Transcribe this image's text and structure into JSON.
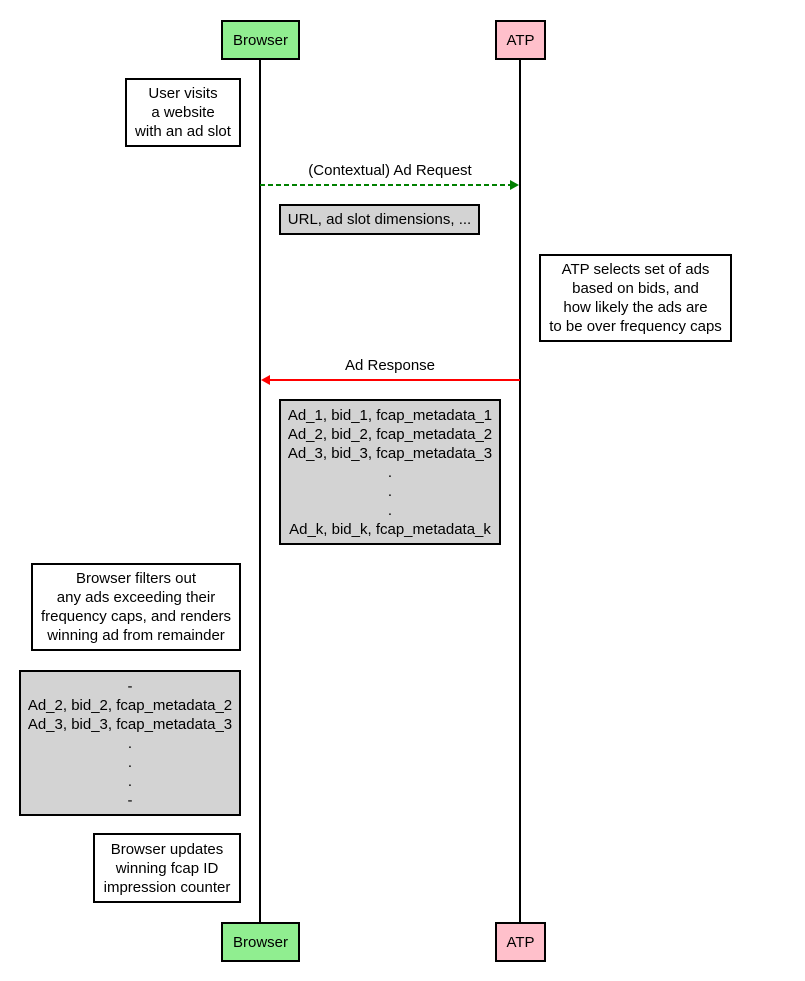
{
  "participants": [
    {
      "name": "Browser",
      "color": "#90ee90"
    },
    {
      "name": "ATP",
      "color": "#ffc0cb"
    }
  ],
  "notes": {
    "user_visits": [
      "User visits",
      "a website",
      "with an ad slot"
    ],
    "atp_selects": [
      "ATP selects set of ads",
      "based on bids, and",
      "how likely the ads are",
      "to be over frequency caps"
    ],
    "browser_filters": [
      "Browser filters out",
      "any ads exceeding their",
      "frequency caps, and renders",
      "winning ad from remainder"
    ],
    "browser_updates": [
      "Browser updates",
      "winning fcap ID",
      "impression counter"
    ]
  },
  "messages": [
    {
      "label": "(Contextual) Ad Request",
      "from": "Browser",
      "to": "ATP",
      "style": "dashed",
      "color": "#008000",
      "payload": [
        "URL, ad slot dimensions, ..."
      ]
    },
    {
      "label": "Ad Response",
      "from": "ATP",
      "to": "Browser",
      "style": "solid",
      "color": "#ff0000",
      "payload": [
        "Ad_1, bid_1, fcap_metadata_1",
        "Ad_2, bid_2, fcap_metadata_2",
        "Ad_3, bid_3, fcap_metadata_3",
        ".",
        ".",
        ".",
        "Ad_k, bid_k, fcap_metadata_k"
      ]
    }
  ],
  "filtered_list": [
    "-",
    "Ad_2, bid_2, fcap_metadata_2",
    "Ad_3, bid_3, fcap_metadata_3",
    ".",
    ".",
    ".",
    "-"
  ]
}
